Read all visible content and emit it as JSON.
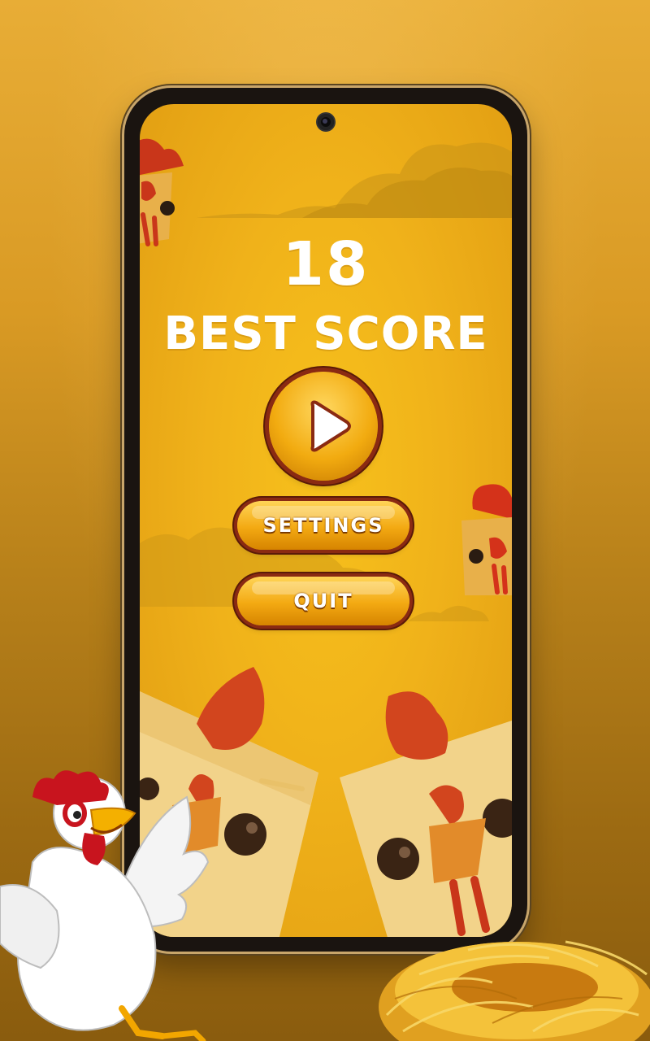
{
  "game": {
    "current_score": "18",
    "best_score_label": "BEST SCORE"
  },
  "menu": {
    "play_icon": "play-icon",
    "settings_label": "SETTINGS",
    "quit_label": "QUIT"
  },
  "colors": {
    "screen_bg": "#f0b21a",
    "button_fill": "#f3a912",
    "button_border": "#8a2a12",
    "text": "#ffffff",
    "rooster_red": "#d2451e"
  }
}
